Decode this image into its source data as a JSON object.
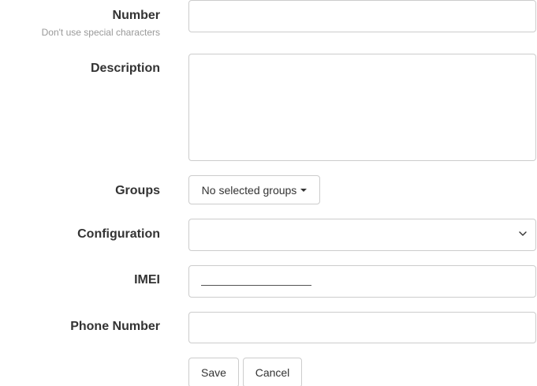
{
  "form": {
    "number": {
      "label": "Number",
      "hint": "Don't use special characters",
      "value": ""
    },
    "description": {
      "label": "Description",
      "value": ""
    },
    "groups": {
      "label": "Groups",
      "button_label": "No selected groups"
    },
    "configuration": {
      "label": "Configuration",
      "selected": ""
    },
    "imei": {
      "label": "IMEI",
      "value": ""
    },
    "phone_number": {
      "label": "Phone Number",
      "value": ""
    }
  },
  "actions": {
    "save_label": "Save",
    "cancel_label": "Cancel"
  },
  "icons": {
    "groups_caret": "caret-down-icon",
    "configuration_chevron": "chevron-down-icon"
  }
}
